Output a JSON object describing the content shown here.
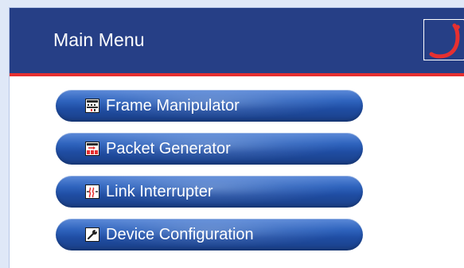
{
  "header": {
    "title": "Main Menu",
    "logo_icon": "red-curve-logo-icon"
  },
  "menu": {
    "items": [
      {
        "label": "Frame Manipulator",
        "icon": "frame-manipulator-icon"
      },
      {
        "label": "Packet Generator",
        "icon": "packet-generator-icon"
      },
      {
        "label": "Link Interrupter",
        "icon": "link-interrupter-icon"
      },
      {
        "label": "Device Configuration",
        "icon": "wrench-icon"
      }
    ]
  },
  "colors": {
    "header_background": "#263f86",
    "accent_red": "#e63030",
    "button_blue": "#2f64be",
    "page_background": "#dfe8f7"
  }
}
